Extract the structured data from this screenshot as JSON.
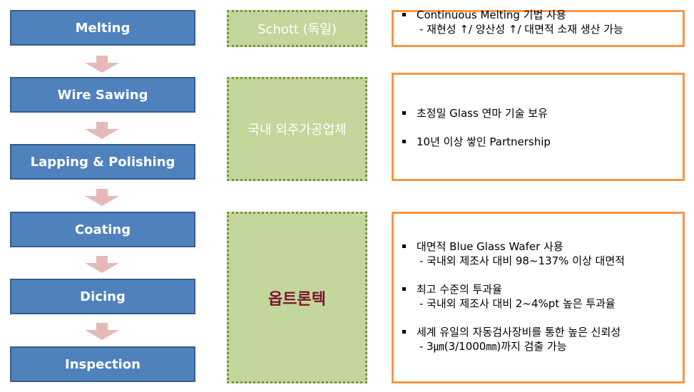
{
  "process_steps": [
    {
      "label": "Melting"
    },
    {
      "label": "Wire Sawing"
    },
    {
      "label": "Lapping & Polishing"
    },
    {
      "label": "Coating"
    },
    {
      "label": "Dicing"
    },
    {
      "label": "Inspection"
    }
  ],
  "arrow_icon": "down-arrow-icon",
  "vendors": [
    {
      "label": "Schott (독일)"
    },
    {
      "label": "국내 외주가공업체"
    },
    {
      "label": "옵트론텍"
    }
  ],
  "details": [
    {
      "bullets": [
        {
          "text": "Continuous Melting 기법 사용",
          "sub": "- 재현성 ↑/ 양산성 ↑/ 대면적 소재 생산 가능"
        }
      ]
    },
    {
      "bullets": [
        {
          "text": "초정밀 Glass 연마 기술 보유",
          "sub": ""
        },
        {
          "text": "10년 이상 쌓인 Partnership",
          "sub": ""
        }
      ]
    },
    {
      "bullets": [
        {
          "text": "대면적 Blue Glass Wafer 사용",
          "sub": "- 국내외 제조사 대비 98~137% 이상 대면적"
        },
        {
          "text": "최고 수준의 투과율",
          "sub": "- 국내외 제조사 대비 2~4%pt 높은 투과율"
        },
        {
          "text": "세계 유일의 자동검사장비를 통한 높은 신뢰성",
          "sub": "- 3㎛(3/1000㎜)까지 검출 가능"
        }
      ]
    }
  ],
  "colors": {
    "step_fill": "#4f81bd",
    "step_border": "#385d8a",
    "arrow_fill": "#e6b9b8",
    "vendor_fill": "#c3d69b",
    "vendor_border": "#77933c",
    "detail_border": "#f79646",
    "highlight_text": "#7b1530"
  }
}
